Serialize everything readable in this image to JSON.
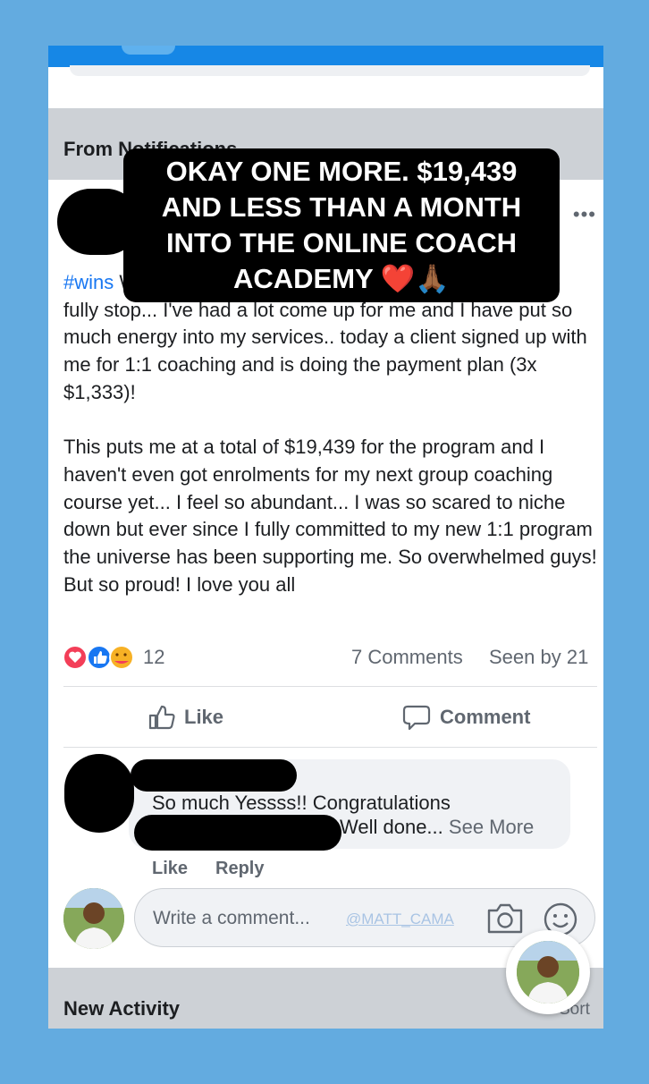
{
  "section_notifications": {
    "title": "From Notifications"
  },
  "overlay_caption": "OKAY ONE MORE. $19,439 AND LESS THAN A MONTH INTO THE ONLINE COACH ACADEMY ❤️🙏🏾",
  "post": {
    "hashtag": "#wins",
    "body_p1": " Wow. wow wow.. Since the universe allowed me to fully stop... I've had a lot come up for me and I have put so much energy into my services.. today a client signed up with me for 1:1 coaching and is doing the payment plan (3x $1,333)!",
    "body_p2": "This puts me at a total of $19,439 for the program and I haven't even got enrolments for my next group coaching course yet... I feel so abundant... I was so scared to niche down but ever since I fully committed to my new 1:1 program the universe has been supporting me. So overwhelmed guys! But so proud! I love you all",
    "reaction_count": "12",
    "comments_count": "7 Comments",
    "seen_by": "Seen by 21"
  },
  "actions": {
    "like_label": "Like",
    "comment_label": "Comment"
  },
  "comment": {
    "text_line1": "So much Yessss!! Congratulations",
    "text_line2": "Well done...",
    "see_more": "See More",
    "like_label": "Like",
    "reply_label": "Reply"
  },
  "compose": {
    "placeholder": "Write a comment...",
    "watermark": "@MATT_CAMA"
  },
  "section_activity": {
    "title": "New Activity",
    "sort_label": "Sort"
  },
  "icons": [
    "heart-reaction-icon",
    "like-reaction-icon",
    "care-reaction-icon",
    "more-options-icon",
    "thumbs-up-icon",
    "speech-bubble-icon",
    "camera-icon",
    "emoji-icon"
  ]
}
